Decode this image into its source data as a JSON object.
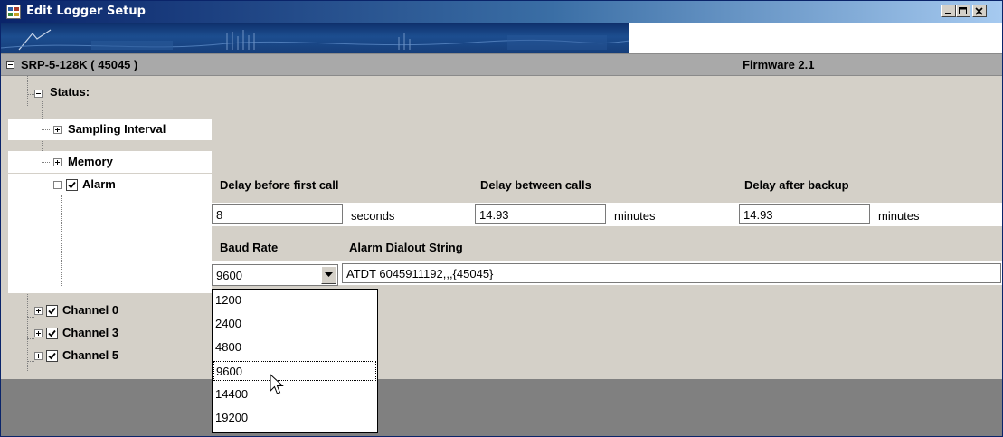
{
  "window": {
    "title": "Edit Logger Setup",
    "buttons": {
      "minimize": "minimize-icon",
      "maximize": "maximize-icon",
      "close": "close-icon"
    }
  },
  "device": {
    "name": "SRP-5-128K ( 45045 )",
    "firmware": "Firmware 2.1"
  },
  "tree": {
    "status": "Status:",
    "sampling_interval": "Sampling Interval",
    "memory": "Memory",
    "alarm": "Alarm",
    "channels": [
      "Channel 0",
      "Channel 3",
      "Channel 5"
    ]
  },
  "alarm": {
    "delay_first_label": "Delay before first call",
    "delay_first_value": "8",
    "delay_first_unit": "seconds",
    "delay_between_label": "Delay between calls",
    "delay_between_value": "14.93",
    "delay_between_unit": "minutes",
    "delay_after_label": "Delay after backup",
    "delay_after_value": "14.93",
    "delay_after_unit": "minutes",
    "baud_label": "Baud Rate",
    "baud_value": "9600",
    "dialout_label": "Alarm Dialout String",
    "dialout_value": "ATDT 6045911192,,,{45045}"
  },
  "baud_options": [
    "1200",
    "2400",
    "4800",
    "9600",
    "14400",
    "19200"
  ],
  "colors": {
    "titlebar": "#0a246a",
    "device_row": "#a9a9a9",
    "panel": "#d4d0c8",
    "bottom": "#808080"
  }
}
